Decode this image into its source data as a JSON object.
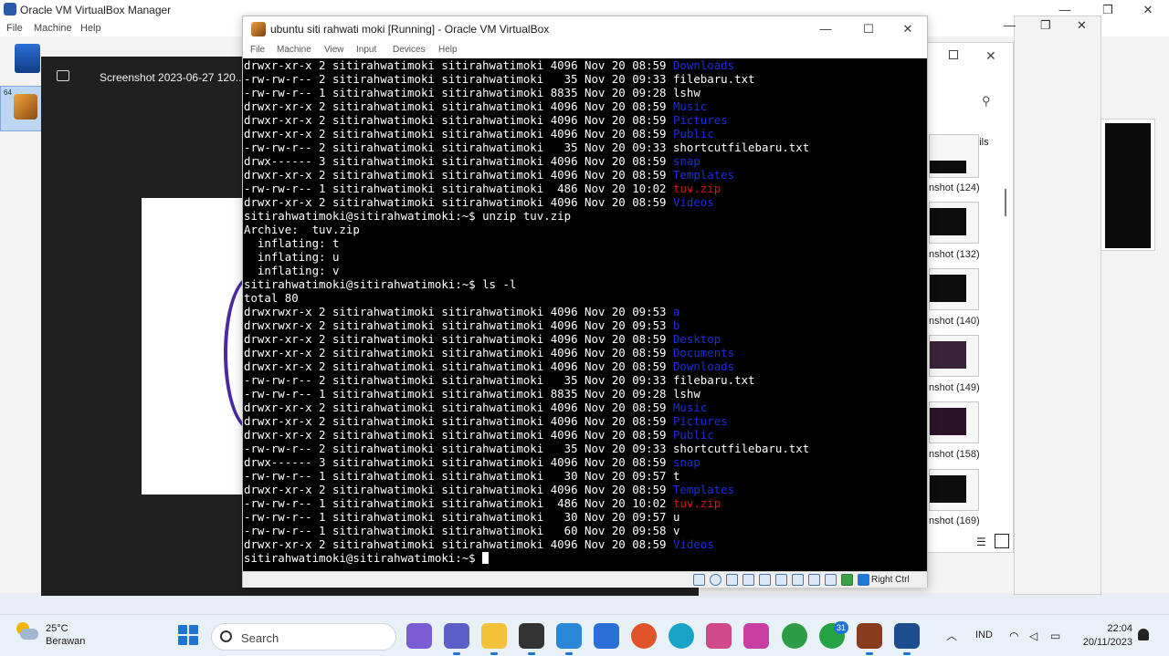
{
  "manager": {
    "title": "Oracle VM VirtualBox Manager",
    "menu": [
      "File",
      "Machine",
      "Help"
    ],
    "vm_badge": "64"
  },
  "viewer": {
    "title": "Screenshot 2023-06-27 120..."
  },
  "explorer": {
    "details_label": "Details",
    "thumbnails": [
      {
        "label": "nshot (124)"
      },
      {
        "label": "nshot (132)"
      },
      {
        "label": "nshot (140)"
      },
      {
        "label": "nshot (149)"
      },
      {
        "label": "nshot (158)"
      },
      {
        "label": "nshot (169)"
      }
    ]
  },
  "vbox": {
    "title": "ubuntu siti rahwati moki [Running] - Oracle VM VirtualBox",
    "menu": [
      "File",
      "Machine",
      "View",
      "Input",
      "Devices",
      "Help"
    ],
    "status_right": "Right Ctrl"
  },
  "terminal": {
    "colors": {
      "dir": "#1d2fd6",
      "zip": "#d01818",
      "text": "#ffffff",
      "bg": "#000000"
    },
    "lines": [
      {
        "pre": "drwxr-xr-x 2 sitirahwatimoki sitirahwatimoki 4096 Nov 20 08:59 ",
        "name": "Downloads",
        "kind": "dir"
      },
      {
        "pre": "-rw-rw-r-- 2 sitirahwatimoki sitirahwatimoki   35 Nov 20 09:33 ",
        "name": "filebaru.txt",
        "kind": "plain"
      },
      {
        "pre": "-rw-rw-r-- 1 sitirahwatimoki sitirahwatimoki 8835 Nov 20 09:28 ",
        "name": "lshw",
        "kind": "plain"
      },
      {
        "pre": "drwxr-xr-x 2 sitirahwatimoki sitirahwatimoki 4096 Nov 20 08:59 ",
        "name": "Music",
        "kind": "dir"
      },
      {
        "pre": "drwxr-xr-x 2 sitirahwatimoki sitirahwatimoki 4096 Nov 20 08:59 ",
        "name": "Pictures",
        "kind": "dir"
      },
      {
        "pre": "drwxr-xr-x 2 sitirahwatimoki sitirahwatimoki 4096 Nov 20 08:59 ",
        "name": "Public",
        "kind": "dir"
      },
      {
        "pre": "-rw-rw-r-- 2 sitirahwatimoki sitirahwatimoki   35 Nov 20 09:33 ",
        "name": "shortcutfilebaru.txt",
        "kind": "plain"
      },
      {
        "pre": "drwx------ 3 sitirahwatimoki sitirahwatimoki 4096 Nov 20 08:59 ",
        "name": "snap",
        "kind": "dir"
      },
      {
        "pre": "drwxr-xr-x 2 sitirahwatimoki sitirahwatimoki 4096 Nov 20 08:59 ",
        "name": "Templates",
        "kind": "dir"
      },
      {
        "pre": "-rw-rw-r-- 1 sitirahwatimoki sitirahwatimoki  486 Nov 20 10:02 ",
        "name": "tuv.zip",
        "kind": "zip"
      },
      {
        "pre": "drwxr-xr-x 2 sitirahwatimoki sitirahwatimoki 4096 Nov 20 08:59 ",
        "name": "Videos",
        "kind": "dir"
      },
      {
        "pre": "sitirahwatimoki@sitirahwatimoki:~$ unzip tuv.zip",
        "name": "",
        "kind": "plain"
      },
      {
        "pre": "Archive:  tuv.zip",
        "name": "",
        "kind": "plain"
      },
      {
        "pre": "  inflating: t",
        "name": "",
        "kind": "plain"
      },
      {
        "pre": "  inflating: u",
        "name": "",
        "kind": "plain"
      },
      {
        "pre": "  inflating: v",
        "name": "",
        "kind": "plain"
      },
      {
        "pre": "sitirahwatimoki@sitirahwatimoki:~$ ls -l",
        "name": "",
        "kind": "plain"
      },
      {
        "pre": "total 80",
        "name": "",
        "kind": "plain"
      },
      {
        "pre": "drwxrwxr-x 2 sitirahwatimoki sitirahwatimoki 4096 Nov 20 09:53 ",
        "name": "a",
        "kind": "dir"
      },
      {
        "pre": "drwxrwxr-x 2 sitirahwatimoki sitirahwatimoki 4096 Nov 20 09:53 ",
        "name": "b",
        "kind": "dir"
      },
      {
        "pre": "drwxr-xr-x 2 sitirahwatimoki sitirahwatimoki 4096 Nov 20 08:59 ",
        "name": "Desktop",
        "kind": "dir"
      },
      {
        "pre": "drwxr-xr-x 2 sitirahwatimoki sitirahwatimoki 4096 Nov 20 08:59 ",
        "name": "Documents",
        "kind": "dir"
      },
      {
        "pre": "drwxr-xr-x 2 sitirahwatimoki sitirahwatimoki 4096 Nov 20 08:59 ",
        "name": "Downloads",
        "kind": "dir"
      },
      {
        "pre": "-rw-rw-r-- 2 sitirahwatimoki sitirahwatimoki   35 Nov 20 09:33 ",
        "name": "filebaru.txt",
        "kind": "plain"
      },
      {
        "pre": "-rw-rw-r-- 1 sitirahwatimoki sitirahwatimoki 8835 Nov 20 09:28 ",
        "name": "lshw",
        "kind": "plain"
      },
      {
        "pre": "drwxr-xr-x 2 sitirahwatimoki sitirahwatimoki 4096 Nov 20 08:59 ",
        "name": "Music",
        "kind": "dir"
      },
      {
        "pre": "drwxr-xr-x 2 sitirahwatimoki sitirahwatimoki 4096 Nov 20 08:59 ",
        "name": "Pictures",
        "kind": "dir"
      },
      {
        "pre": "drwxr-xr-x 2 sitirahwatimoki sitirahwatimoki 4096 Nov 20 08:59 ",
        "name": "Public",
        "kind": "dir"
      },
      {
        "pre": "-rw-rw-r-- 2 sitirahwatimoki sitirahwatimoki   35 Nov 20 09:33 ",
        "name": "shortcutfilebaru.txt",
        "kind": "plain"
      },
      {
        "pre": "drwx------ 3 sitirahwatimoki sitirahwatimoki 4096 Nov 20 08:59 ",
        "name": "snap",
        "kind": "dir"
      },
      {
        "pre": "-rw-rw-r-- 1 sitirahwatimoki sitirahwatimoki   30 Nov 20 09:57 ",
        "name": "t",
        "kind": "plain"
      },
      {
        "pre": "drwxr-xr-x 2 sitirahwatimoki sitirahwatimoki 4096 Nov 20 08:59 ",
        "name": "Templates",
        "kind": "dir"
      },
      {
        "pre": "-rw-rw-r-- 1 sitirahwatimoki sitirahwatimoki  486 Nov 20 10:02 ",
        "name": "tuv.zip",
        "kind": "zip"
      },
      {
        "pre": "-rw-rw-r-- 1 sitirahwatimoki sitirahwatimoki   30 Nov 20 09:57 ",
        "name": "u",
        "kind": "plain"
      },
      {
        "pre": "-rw-rw-r-- 1 sitirahwatimoki sitirahwatimoki   60 Nov 20 09:58 ",
        "name": "v",
        "kind": "plain"
      },
      {
        "pre": "drwxr-xr-x 2 sitirahwatimoki sitirahwatimoki 4096 Nov 20 08:59 ",
        "name": "Videos",
        "kind": "dir"
      }
    ],
    "prompt": "sitirahwatimoki@sitirahwatimoki:~$ "
  },
  "taskbar": {
    "weather_temp": "25°C",
    "weather_desc": "Berawan",
    "search_placeholder": "Search",
    "whatsapp_badge": "31",
    "lang": "IND",
    "time": "22:04",
    "date": "20/11/2023",
    "apps": [
      {
        "name": "copilot-icon",
        "color": "#7b5cd6"
      },
      {
        "name": "teams-icon",
        "color": "#5b5fc7"
      },
      {
        "name": "file-explorer-icon",
        "color": "#f3c13a"
      },
      {
        "name": "paint-app-icon",
        "color": "#333333"
      },
      {
        "name": "photos-icon",
        "color": "#2b88d8"
      },
      {
        "name": "code-app-icon",
        "color": "#2a6fd6"
      },
      {
        "name": "firefox-icon",
        "color": "#e0542c"
      },
      {
        "name": "edge-icon",
        "color": "#1aa3c8"
      },
      {
        "name": "snip-tool-icon",
        "color": "#d04a8a"
      },
      {
        "name": "wps-office-icon",
        "color": "#c93ea3"
      },
      {
        "name": "chrome-icon",
        "color": "#2e9c44"
      },
      {
        "name": "whatsapp-icon",
        "color": "#25a244"
      },
      {
        "name": "winrar-icon",
        "color": "#8a3b1e"
      },
      {
        "name": "virtualbox-icon",
        "color": "#1d4c8f"
      }
    ]
  }
}
